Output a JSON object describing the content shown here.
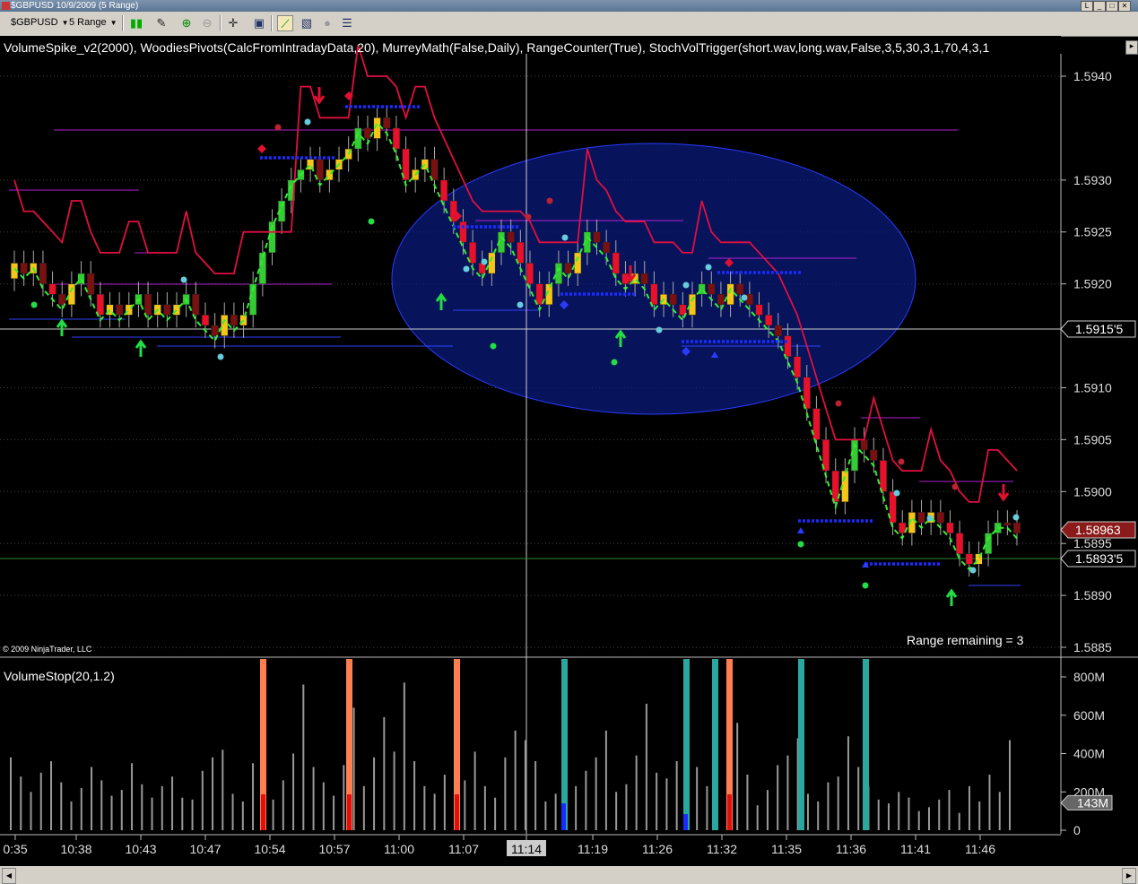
{
  "window": {
    "title": "$GBPUSD  10/9/2009 (5 Range)",
    "buttons": [
      "L",
      "_",
      "□",
      "✕"
    ]
  },
  "toolbar": {
    "instrument": "$GBPUSD",
    "interval": "5 Range"
  },
  "indicators_text": "VolumeSpike_v2(2000),  WoodiesPivots(CalcFromIntradayData,20),  MurreyMath(False,Daily),  RangeCounter(True),  StochVolTrigger(short.wav,long.wav,False,3,5,30,3,1,70,4,3,1",
  "copyright": "© 2009 NinjaTrader, LLC",
  "range_remaining": "Range remaining = 3",
  "price_axis": {
    "ticks": [
      "1.5940",
      "1.5930",
      "1.5925",
      "1.5920",
      "1.5910",
      "1.5905",
      "1.5900",
      "1.5895",
      "1.5890",
      "1.5885"
    ],
    "tick_values": [
      1.594,
      1.593,
      1.5925,
      1.592,
      1.591,
      1.5905,
      1.59,
      1.5895,
      1.589,
      1.5885
    ],
    "last_price": "1.58963",
    "crosshair_price": "1.5915'5",
    "green_level": "1.5893'5",
    "last_price_color": "#8b1a1a"
  },
  "volume_panel": {
    "label": "VolumeStop(20,1.2)",
    "ticks": [
      "800M",
      "600M",
      "400M",
      "200M",
      "0"
    ],
    "current_label": "143M"
  },
  "time_axis": {
    "labels": [
      "0:35",
      "10:38",
      "10:43",
      "10:47",
      "10:54",
      "10:57",
      "11:00",
      "11:07",
      "11:14",
      "11:19",
      "11:26",
      "11:32",
      "11:35",
      "11:36",
      "11:41",
      "11:46"
    ],
    "highlighted": "11:14"
  },
  "chart_data": {
    "type": "candlestick",
    "instrument": "$GBPUSD",
    "ylim": [
      1.5883,
      1.5944
    ],
    "candles_close": [
      1.5922,
      1.5921,
      1.5922,
      1.592,
      1.5919,
      1.5918,
      1.592,
      1.5921,
      1.5919,
      1.5917,
      1.5918,
      1.5917,
      1.5918,
      1.5919,
      1.5917,
      1.5918,
      1.5917,
      1.5918,
      1.5919,
      1.5917,
      1.5916,
      1.5915,
      1.5917,
      1.5916,
      1.5917,
      1.592,
      1.5923,
      1.5926,
      1.5928,
      1.593,
      1.5931,
      1.5932,
      1.593,
      1.5931,
      1.5932,
      1.5933,
      1.5935,
      1.5934,
      1.5936,
      1.5935,
      1.5933,
      1.593,
      1.5931,
      1.5932,
      1.593,
      1.5928,
      1.5926,
      1.5924,
      1.5922,
      1.5921,
      1.5923,
      1.5925,
      1.5924,
      1.5922,
      1.592,
      1.5918,
      1.592,
      1.5922,
      1.5921,
      1.5923,
      1.5925,
      1.5924,
      1.5923,
      1.5921,
      1.592,
      1.5921,
      1.592,
      1.5918,
      1.5919,
      1.5918,
      1.5917,
      1.5919,
      1.592,
      1.5919,
      1.5918,
      1.592,
      1.5919,
      1.5918,
      1.5917,
      1.5916,
      1.5915,
      1.5913,
      1.5911,
      1.5908,
      1.5905,
      1.5902,
      1.5899,
      1.5902,
      1.5905,
      1.5904,
      1.5903,
      1.59,
      1.5897,
      1.5896,
      1.5898,
      1.5897,
      1.5898,
      1.5897,
      1.5896,
      1.5894,
      1.5893,
      1.5894,
      1.5896,
      1.5897,
      1.5897,
      1.5896
    ],
    "volume_bars_M": [
      380,
      280,
      200,
      300,
      360,
      250,
      150,
      220,
      330,
      260,
      180,
      210,
      350,
      240,
      170,
      230,
      280,
      170,
      160,
      310,
      380,
      420,
      190,
      150,
      350,
      210,
      160,
      260,
      400,
      760,
      330,
      250,
      180,
      340,
      640,
      230,
      380,
      590,
      410,
      770,
      360,
      230,
      190,
      290,
      180,
      260,
      410,
      230,
      170,
      380,
      520,
      470,
      360,
      150,
      190,
      250,
      230,
      310,
      380,
      520,
      200,
      240,
      390,
      660,
      300,
      270,
      360,
      200,
      330,
      230,
      150,
      290,
      560,
      290,
      130,
      210,
      340,
      390,
      480,
      190,
      150,
      250,
      280,
      490,
      330,
      230,
      160,
      140,
      200,
      170,
      100,
      120,
      160,
      210,
      90,
      230,
      150,
      290,
      200,
      470
    ],
    "signal_bars": [
      {
        "time": "10:54",
        "color": "#ff7f50"
      },
      {
        "time": "10:57",
        "color": "#ff7f50"
      },
      {
        "time": "11:07",
        "color": "#ff7f50"
      },
      {
        "time": "11:14",
        "color": "#2aa8a0"
      },
      {
        "time": "11:26",
        "color": "#2aa8a0"
      },
      {
        "time": "11:32",
        "color": "#2aa8a0"
      },
      {
        "time": "11:32",
        "color": "#ff7f50"
      },
      {
        "time": "11:35",
        "color": "#2aa8a0"
      },
      {
        "time": "11:36",
        "color": "#2aa8a0"
      }
    ],
    "colors": {
      "bull": "#33cc33",
      "bear": "#e8102a",
      "neutral": "#f5c518",
      "dark_bear": "#7a1010",
      "trail": "#e01040",
      "pivot": "#1a2bff",
      "ellipse": "#0a1a7a"
    }
  }
}
